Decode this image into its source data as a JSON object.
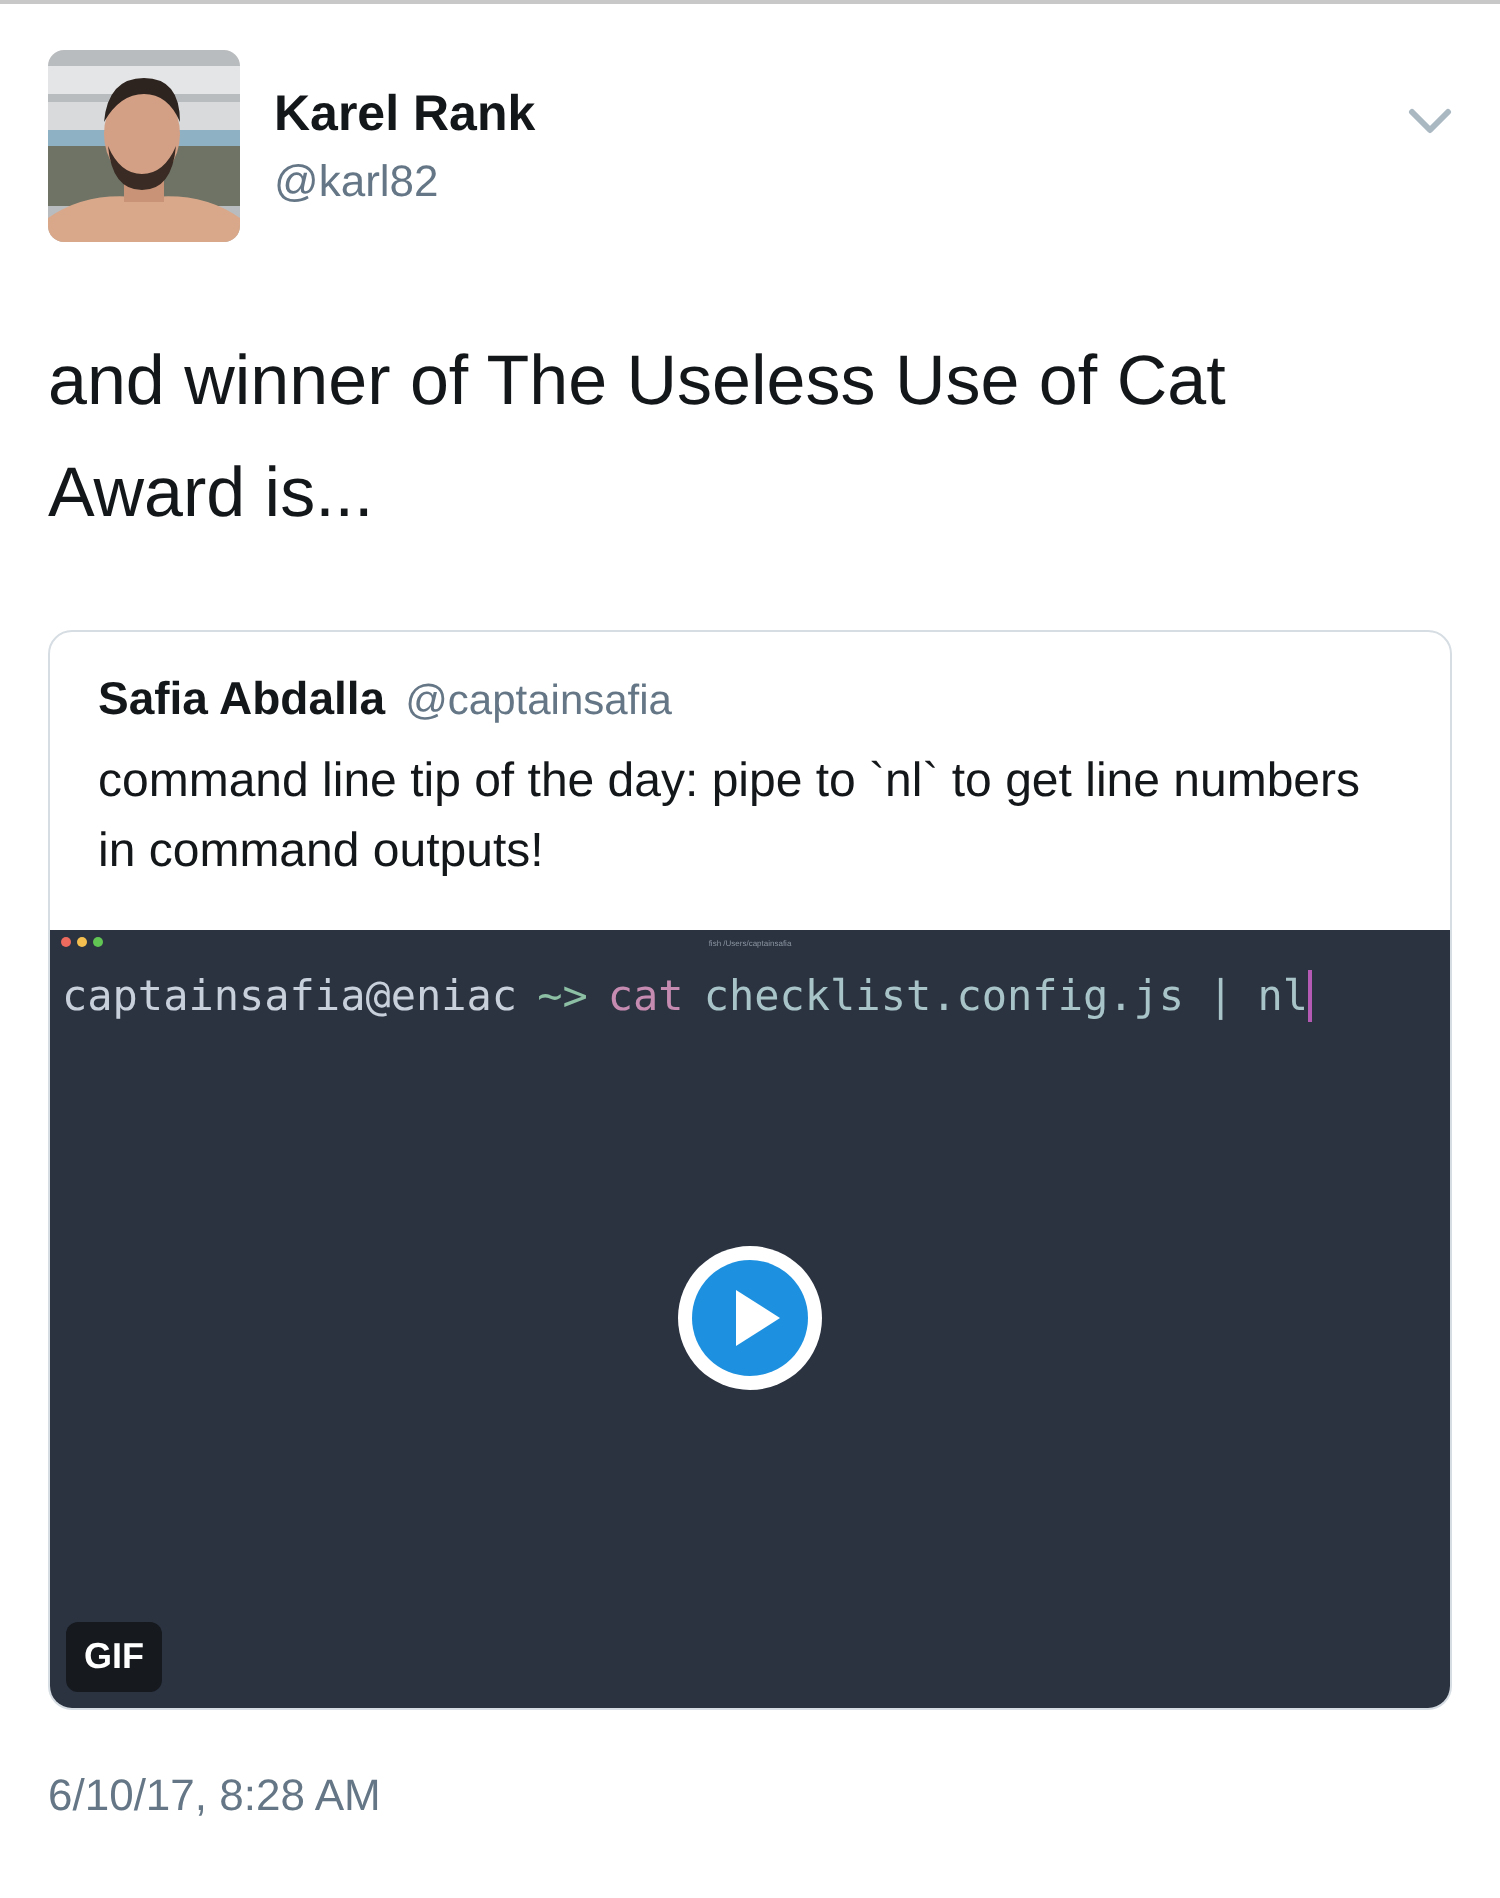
{
  "tweet": {
    "author": {
      "name": "Karel Rank",
      "handle": "@karl82"
    },
    "text": "and winner of The Useless Use of Cat Award is...",
    "quoted": {
      "author": {
        "name": "Safia Abdalla",
        "handle": "@captainsafia"
      },
      "text": "command line tip of the day: pipe to `nl` to get line numbers in command outputs!",
      "media": {
        "kind": "gif",
        "badge": "GIF",
        "terminal": {
          "title": "fish /Users/captainsafia",
          "prompt_user": "captainsafia@eniac",
          "prompt_symbol": "~>",
          "command": "cat",
          "args": "checklist.config.js",
          "pipe": "|",
          "pipe_command": "nl"
        }
      }
    },
    "timestamp": "6/10/17, 8:28 AM"
  }
}
